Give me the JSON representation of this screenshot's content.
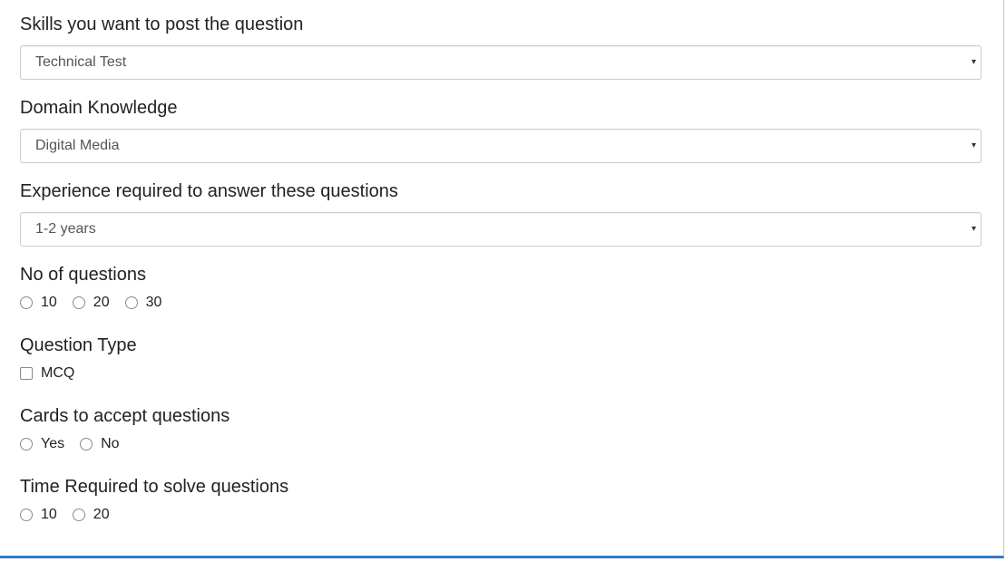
{
  "fields": {
    "skills": {
      "label": "Skills you want to post the question",
      "value": "Technical Test"
    },
    "domain": {
      "label": "Domain Knowledge",
      "value": "Digital Media"
    },
    "experience": {
      "label": "Experience required to answer these questions",
      "value": "1-2 years"
    },
    "num_questions": {
      "label": "No of questions",
      "options": [
        "10",
        "20",
        "30"
      ]
    },
    "question_type": {
      "label": "Question Type",
      "options": [
        "MCQ"
      ]
    },
    "cards": {
      "label": "Cards to accept questions",
      "options": [
        "Yes",
        "No"
      ]
    },
    "time_required": {
      "label": "Time Required to solve questions",
      "options": [
        "10",
        "20"
      ]
    }
  },
  "icons": {
    "select_caret": "▾"
  }
}
